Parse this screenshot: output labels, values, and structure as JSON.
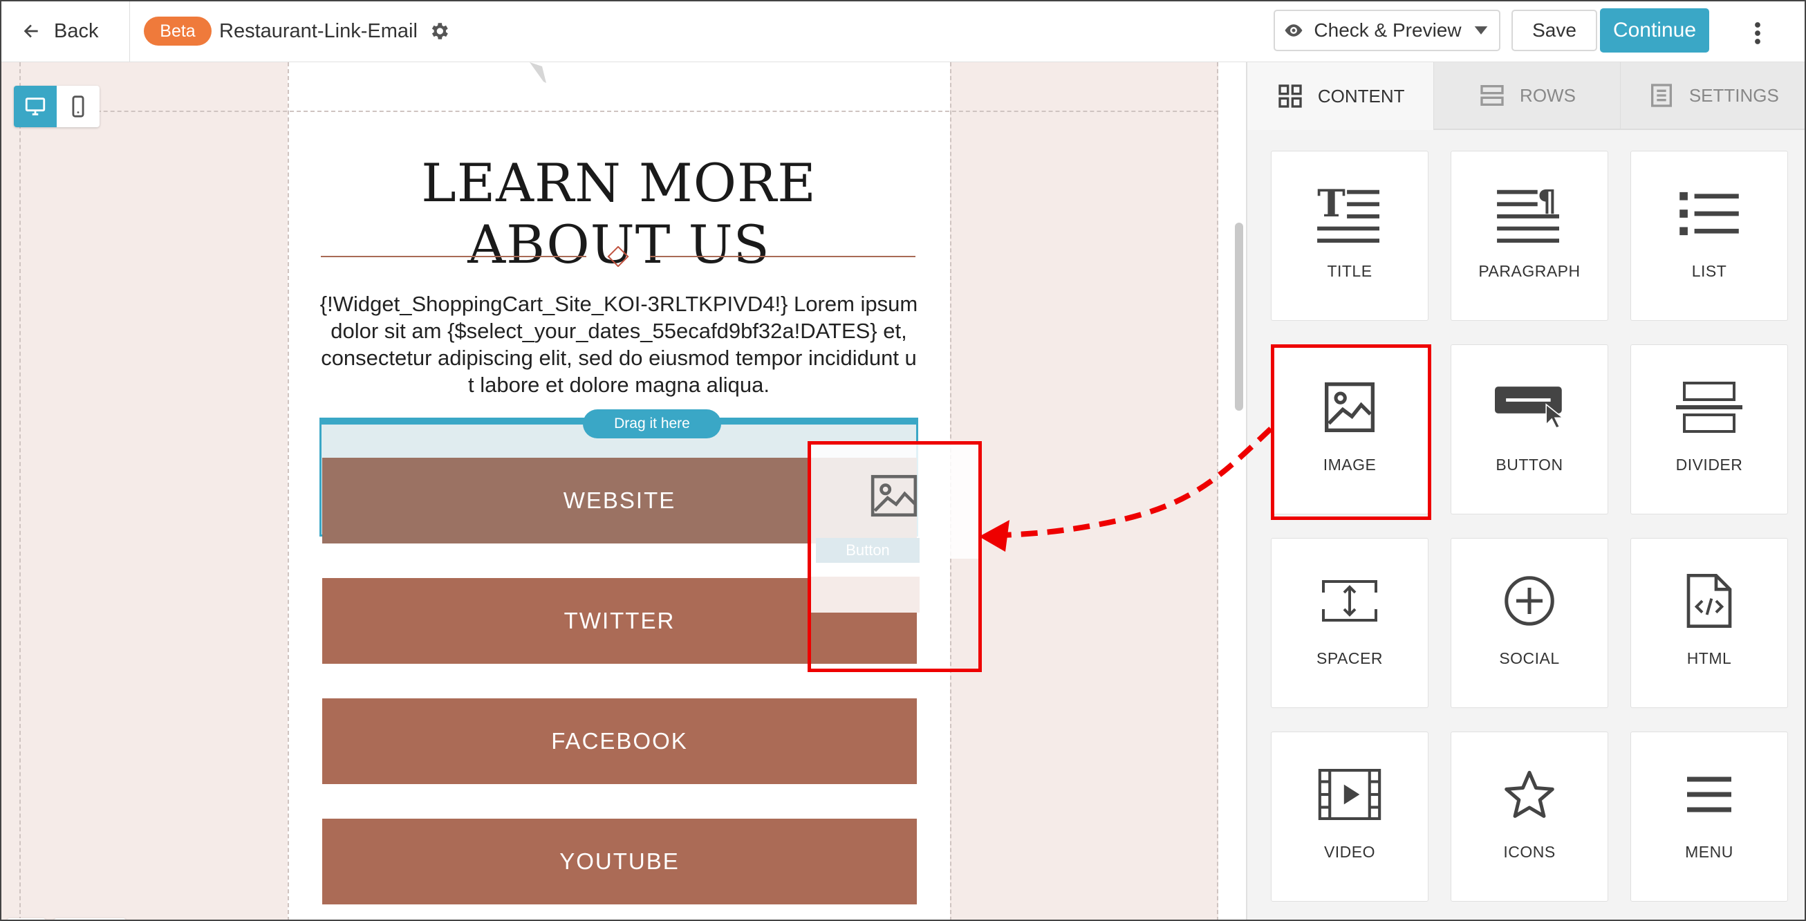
{
  "topbar": {
    "back_label": "Back",
    "beta_badge": "Beta",
    "document_name": "Restaurant-Link-Email",
    "preview_label": "Check & Preview",
    "save_label": "Save",
    "continue_label": "Continue"
  },
  "colors": {
    "accent": "#3aa7c6",
    "beta": "#ef7a3b",
    "link_button": "#ab6b56",
    "canvas_bg": "#f5ebe8",
    "highlight": "#ee0000"
  },
  "email": {
    "headline": "LEARN MORE ABOUT US",
    "body": "{!Widget_ShoppingCart_Site_KOI-3RLTKPIVD4!} Lorem ipsum dolor sit am {$select_your_dates_55ecafd9bf32a!DATES} et, consectetur adipiscing elit, sed do eiusmod tempor incididunt u t labore et dolore magna aliqua.",
    "drop_hint": "Drag it here",
    "buttons": [
      "WEBSITE",
      "TWITTER",
      "FACEBOOK",
      "YOUTUBE"
    ],
    "ghost_label": "Button"
  },
  "panel": {
    "tabs": [
      "CONTENT",
      "ROWS",
      "SETTINGS"
    ],
    "active_tab": "CONTENT",
    "blocks": [
      {
        "label": "TITLE",
        "icon": "title-icon"
      },
      {
        "label": "PARAGRAPH",
        "icon": "paragraph-icon"
      },
      {
        "label": "LIST",
        "icon": "list-icon"
      },
      {
        "label": "IMAGE",
        "icon": "image-icon"
      },
      {
        "label": "BUTTON",
        "icon": "button-icon"
      },
      {
        "label": "DIVIDER",
        "icon": "divider-icon"
      },
      {
        "label": "SPACER",
        "icon": "spacer-icon"
      },
      {
        "label": "SOCIAL",
        "icon": "social-icon"
      },
      {
        "label": "HTML",
        "icon": "html-icon"
      },
      {
        "label": "VIDEO",
        "icon": "video-icon"
      },
      {
        "label": "ICONS",
        "icon": "star-icon"
      },
      {
        "label": "MENU",
        "icon": "menu-icon"
      }
    ]
  }
}
